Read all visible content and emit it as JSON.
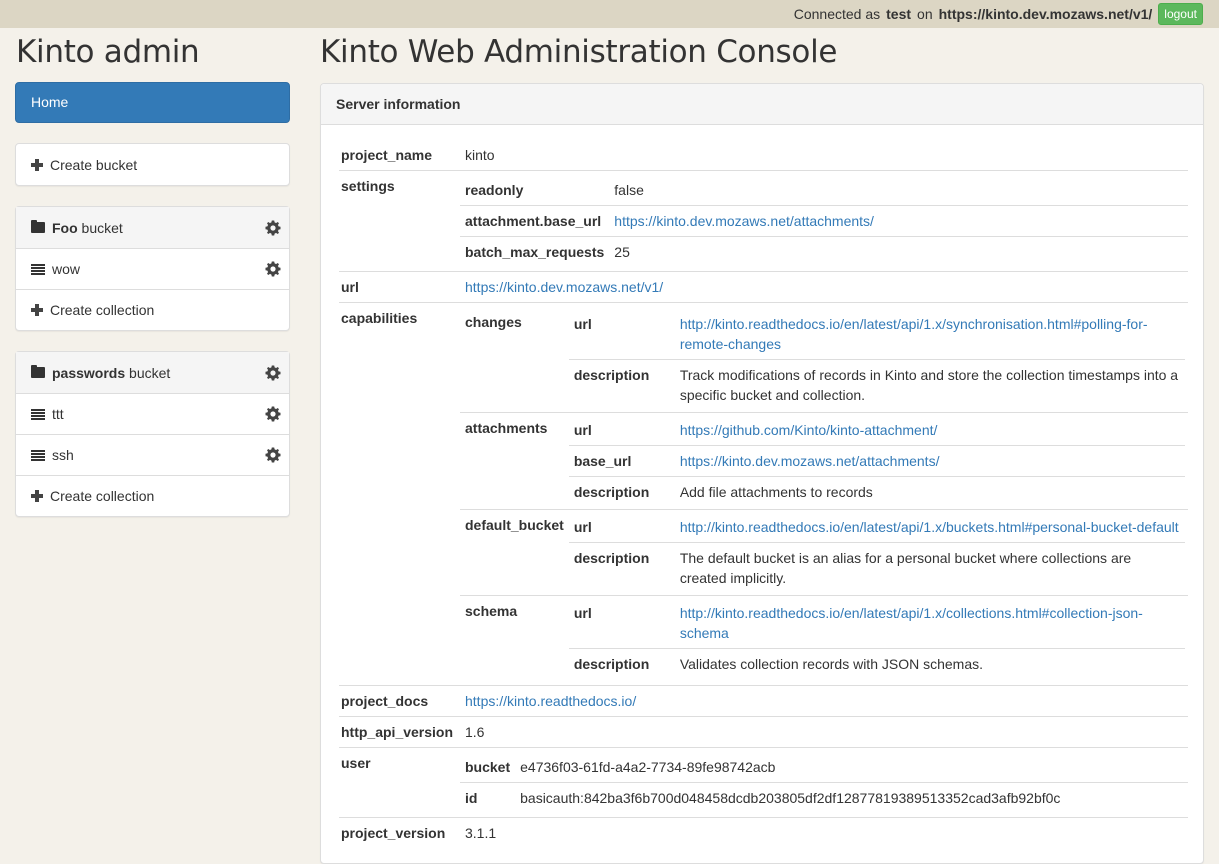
{
  "topbar": {
    "connected_prefix": "Connected as",
    "user": "test",
    "on_word": "on",
    "server": "https://kinto.dev.mozaws.net/v1/",
    "logout_label": "logout"
  },
  "sidebar": {
    "brand": "Kinto admin",
    "home_label": "Home",
    "create_bucket_label": "Create bucket",
    "buckets": [
      {
        "name": "Foo",
        "suffix": "bucket",
        "collections": [
          "wow"
        ],
        "create_collection_label": "Create collection"
      },
      {
        "name": "passwords",
        "suffix": "bucket",
        "collections": [
          "ttt",
          "ssh"
        ],
        "create_collection_label": "Create collection"
      }
    ]
  },
  "main": {
    "title": "Kinto Web Administration Console",
    "panel_title": "Server information",
    "info": {
      "project_name": {
        "key": "project_name",
        "value": "kinto"
      },
      "settings": {
        "key": "settings",
        "readonly": {
          "key": "readonly",
          "value": "false"
        },
        "attachment_base_url": {
          "key": "attachment.base_url",
          "value": "https://kinto.dev.mozaws.net/attachments/"
        },
        "batch_max_requests": {
          "key": "batch_max_requests",
          "value": "25"
        }
      },
      "url": {
        "key": "url",
        "value": "https://kinto.dev.mozaws.net/v1/"
      },
      "capabilities": {
        "key": "capabilities",
        "url_key": "url",
        "description_key": "description",
        "base_url_key": "base_url",
        "changes": {
          "key": "changes",
          "url": "http://kinto.readthedocs.io/en/latest/api/1.x/synchronisation.html#polling-for-remote-changes",
          "description": "Track modifications of records in Kinto and store the collection timestamps into a specific bucket and collection."
        },
        "attachments": {
          "key": "attachments",
          "url": "https://github.com/Kinto/kinto-attachment/",
          "base_url": "https://kinto.dev.mozaws.net/attachments/",
          "description": "Add file attachments to records"
        },
        "default_bucket": {
          "key": "default_bucket",
          "url": "http://kinto.readthedocs.io/en/latest/api/1.x/buckets.html#personal-bucket-default",
          "description": "The default bucket is an alias for a personal bucket where collections are created implicitly."
        },
        "schema": {
          "key": "schema",
          "url": "http://kinto.readthedocs.io/en/latest/api/1.x/collections.html#collection-json-schema",
          "description": "Validates collection records with JSON schemas."
        }
      },
      "project_docs": {
        "key": "project_docs",
        "value": "https://kinto.readthedocs.io/"
      },
      "http_api_version": {
        "key": "http_api_version",
        "value": "1.6"
      },
      "user": {
        "key": "user",
        "bucket": {
          "key": "bucket",
          "value": "e4736f03-61fd-a4a2-7734-89fe98742acb"
        },
        "id": {
          "key": "id",
          "value": "basicauth:842ba3f6b700d048458dcdb203805df2df12877819389513352cad3afb92bf0c"
        }
      },
      "project_version": {
        "key": "project_version",
        "value": "3.1.1"
      }
    }
  },
  "icons": {
    "plus": "plus-icon",
    "bucket": "folder-icon",
    "collection": "list-icon",
    "settings": "gear-icon"
  },
  "colors": {
    "primary": "#337ab7",
    "success": "#5cb85c",
    "topbar": "#dcd6c4",
    "background": "#f4f1ea"
  }
}
